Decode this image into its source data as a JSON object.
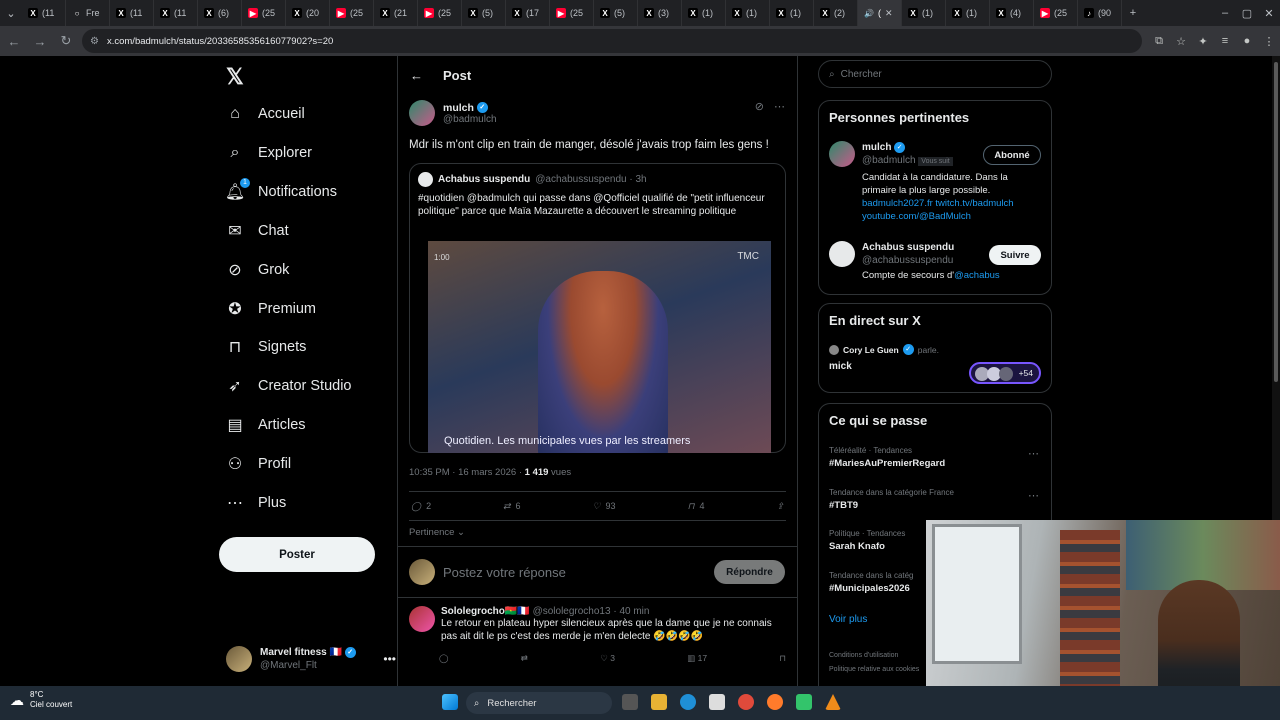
{
  "browser": {
    "tabs": [
      {
        "label": "(11",
        "icon": "x-icon"
      },
      {
        "label": "Fre",
        "icon": "loading-icon"
      },
      {
        "label": "(11",
        "icon": "x-icon"
      },
      {
        "label": "(11",
        "icon": "x-icon"
      },
      {
        "label": "(6)",
        "icon": "x-icon"
      },
      {
        "label": "(25",
        "icon": "youtube-icon"
      },
      {
        "label": "(20",
        "icon": "x-icon"
      },
      {
        "label": "(25",
        "icon": "youtube-icon"
      },
      {
        "label": "(21",
        "icon": "x-icon"
      },
      {
        "label": "(25",
        "icon": "youtube-icon"
      },
      {
        "label": "(5)",
        "icon": "x-icon"
      },
      {
        "label": "(17",
        "icon": "x-icon"
      },
      {
        "label": "(25",
        "icon": "youtube-icon"
      },
      {
        "label": "(5)",
        "icon": "x-icon"
      },
      {
        "label": "(3)",
        "icon": "x-icon"
      },
      {
        "label": "(1)",
        "icon": "x-icon"
      },
      {
        "label": "(1)",
        "icon": "x-icon"
      },
      {
        "label": "(1)",
        "icon": "x-icon"
      },
      {
        "label": "(2)",
        "icon": "x-icon"
      },
      {
        "label": "(",
        "icon": "audio-icon",
        "active": true
      },
      {
        "label": "(1)",
        "icon": "x-icon"
      },
      {
        "label": "(1)",
        "icon": "x-icon"
      },
      {
        "label": "(4)",
        "icon": "x-icon"
      },
      {
        "label": "(25",
        "icon": "youtube-icon"
      },
      {
        "label": "(90",
        "icon": "tiktok-icon"
      }
    ],
    "url": "x.com/badmulch/status/2033658535616077902?s=20"
  },
  "nav": {
    "items": [
      {
        "label": "Accueil",
        "icon": "home-icon"
      },
      {
        "label": "Explorer",
        "icon": "search-icon"
      },
      {
        "label": "Notifications",
        "icon": "bell-icon",
        "badge": "1"
      },
      {
        "label": "Chat",
        "icon": "mail-icon"
      },
      {
        "label": "Grok",
        "icon": "grok-icon"
      },
      {
        "label": "Premium",
        "icon": "verified-icon"
      },
      {
        "label": "Signets",
        "icon": "bookmark-icon"
      },
      {
        "label": "Creator Studio",
        "icon": "rocket-icon"
      },
      {
        "label": "Articles",
        "icon": "article-icon"
      },
      {
        "label": "Profil",
        "icon": "user-icon"
      },
      {
        "label": "Plus",
        "icon": "more-circle-icon"
      }
    ],
    "post_label": "Poster",
    "account": {
      "name": "Marvel fitness 🇫🇷",
      "handle": "@Marvel_Flt"
    }
  },
  "main": {
    "header": "Post",
    "tweet": {
      "name": "mulch",
      "handle": "@badmulch",
      "text": "Mdr ils m'ont clip en train de manger, désolé j'avais trop faim les gens !",
      "quote": {
        "name": "Achabus suspendu",
        "handle": "@achabussuspendu · 3h",
        "text": "#quotidien @badmulch qui passe dans @Qofficiel qualifié de \"petit influenceur politique\" parce que Maïa Mazaurette a découvert le streaming politique",
        "video_caption": "Quotidien. Les municipales vues par les streamers",
        "video_time": "1:00",
        "video_logo": "TMC"
      },
      "time": "10:35 PM · 16 mars 2026 · ",
      "views_count": "1 419",
      "views_label": " vues",
      "replies": "2",
      "reposts": "6",
      "likes": "93",
      "bookmarks": "4"
    },
    "sort_label": "Pertinence",
    "reply_placeholder": "Postez votre réponse",
    "reply_button": "Répondre",
    "reply": {
      "name": "Sololegrocho🇧🇫🇫🇷",
      "handle": "@sololegrocho13 · 40 min",
      "text": "Le retour en plateau hyper silencieux après que la dame que je ne connais pas ait dit le ps c'est des merde je m'en delecte 🤣🤣🤣🤣",
      "replies": "",
      "reposts": "",
      "likes": "3",
      "views": "17"
    }
  },
  "right": {
    "search_placeholder": "Chercher",
    "relevant": {
      "title": "Personnes pertinentes",
      "p1": {
        "name": "mulch",
        "handle": "@badmulch",
        "follows_you": "Vous suit",
        "button": "Abonné",
        "bio": "Candidat à la candidature. Dans la primaire la plus large possible.",
        "link1": "badmulch2027.fr",
        "link2": "twitch.tv/badmulch",
        "link3": "youtube.com/@BadMulch"
      },
      "p2": {
        "name": "Achabus suspendu",
        "handle": "@achabussuspendu",
        "button": "Suivre",
        "bio": "Compte de secours d'",
        "bio_link": "@achabus"
      }
    },
    "live": {
      "title": "En direct sur X",
      "host": "Cory Le Guen",
      "host_suffix": "parle.",
      "space": "mick",
      "count": "+54"
    },
    "trends": {
      "title": "Ce qui se passe",
      "items": [
        {
          "cat": "Téléréalité · Tendances",
          "tag": "#MariesAuPremierRegard"
        },
        {
          "cat": "Tendance dans la catégorie France",
          "tag": "#TBT9"
        },
        {
          "cat": "Politique · Tendances",
          "tag": "Sarah Knafo"
        },
        {
          "cat": "Tendance dans la catég",
          "tag": "#Municipales2026"
        }
      ],
      "more": "Voir plus"
    },
    "footer": {
      "line1": "Conditions d'utilisation",
      "line2": "Politique relative aux cookies"
    }
  },
  "taskbar": {
    "temp": "8°C",
    "weather": "Ciel couvert",
    "search": "Rechercher"
  }
}
